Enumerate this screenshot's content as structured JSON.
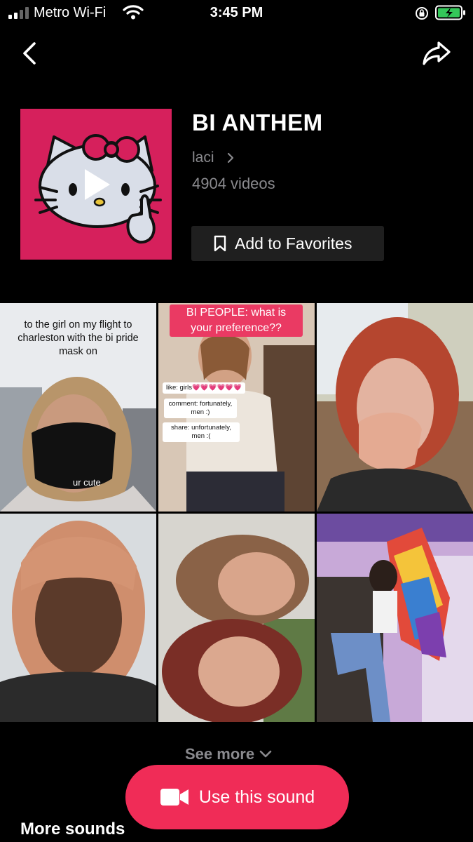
{
  "status_bar": {
    "carrier": "Metro Wi-Fi",
    "time": "3:45 PM",
    "icons": [
      "signal-icon",
      "wifi-icon",
      "orientation-lock-icon",
      "battery-charging-icon"
    ],
    "battery_color": "#34c759"
  },
  "nav": {
    "back_icon": "chevron-left-icon",
    "share_icon": "share-arrow-icon"
  },
  "sound": {
    "title": "BI ANTHEM",
    "artist": "laci",
    "video_count": "4904 videos",
    "favorites_label": "Add to Favorites",
    "cover_color": "#d6205c"
  },
  "videos": [
    {
      "caption": "to the girl on my flight to charleston with the bi pride mask on",
      "overlay": "ur cute"
    },
    {
      "tag": "BI PEOPLE: what is your preference??",
      "notes": [
        "like: girls💗💗💗💗💗💗",
        "comment: fortunately, men :)",
        "share: unfortunately, men :("
      ]
    },
    {},
    {},
    {},
    {}
  ],
  "footer": {
    "see_more": "See more",
    "use_sound": "Use this sound",
    "more_sounds": "More sounds",
    "accent": "#f02c57"
  }
}
